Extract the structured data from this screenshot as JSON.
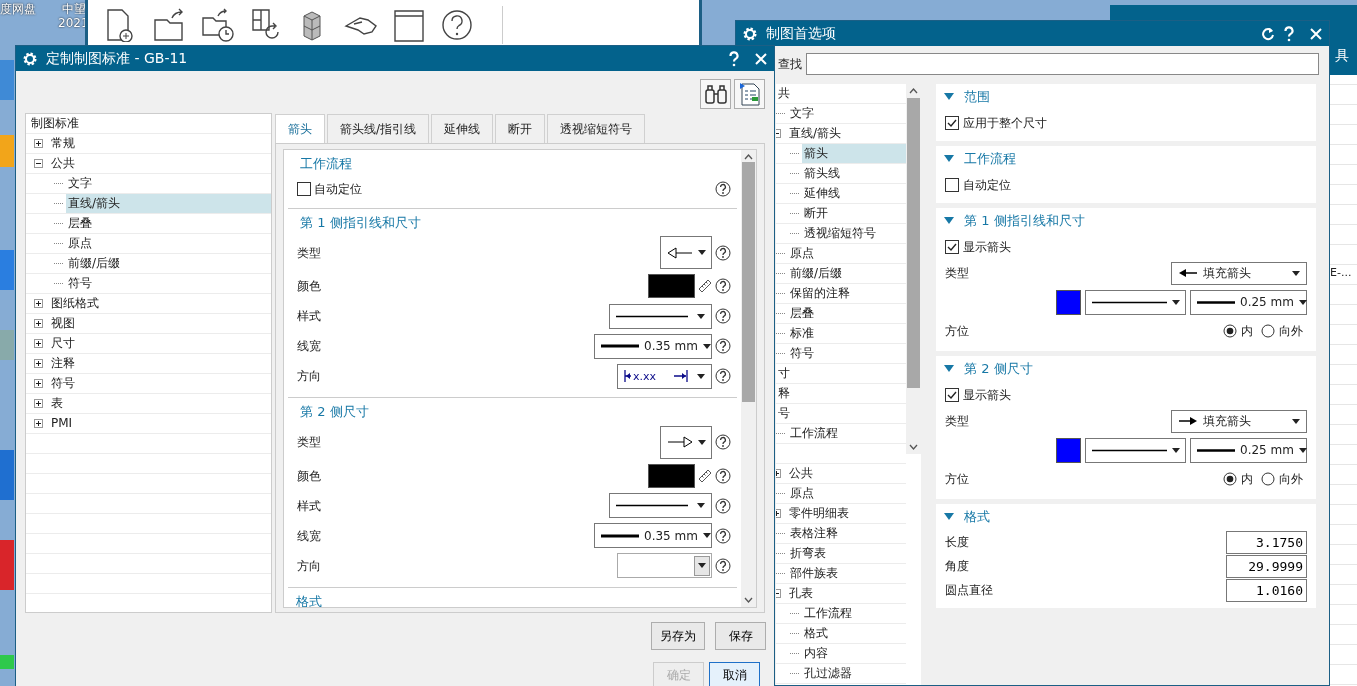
{
  "desktop": {
    "icon_labels": [
      "度网盘",
      "中望",
      "2021"
    ]
  },
  "background_window": {
    "texts": [
      "具",
      "E-..."
    ]
  },
  "preferences_dialog": {
    "title": "制图首选项",
    "search": {
      "label": "查找"
    },
    "tree": [
      {
        "label": "共",
        "children": [
          {
            "label": "文字",
            "selected": false
          },
          {
            "label": "直线/箭头",
            "expanded": true,
            "selected": false,
            "children": [
              {
                "label": "箭头",
                "selected": true
              },
              {
                "label": "箭头线",
                "selected": false
              },
              {
                "label": "延伸线",
                "selected": false
              },
              {
                "label": "断开",
                "selected": false
              },
              {
                "label": "透视缩短符号",
                "selected": false
              }
            ]
          },
          {
            "label": "原点",
            "selected": false
          },
          {
            "label": "前缀/后缀",
            "selected": false
          },
          {
            "label": "保留的注释",
            "selected": false
          },
          {
            "label": "层叠",
            "selected": false
          },
          {
            "label": "标准",
            "selected": false
          },
          {
            "label": "符号",
            "selected": false
          }
        ],
        "selected": false
      },
      {
        "label": "寸",
        "selected": false
      },
      {
        "label": "释",
        "selected": false
      },
      {
        "label": "号",
        "selected": false,
        "children": [
          {
            "label": "工作流程",
            "selected": false
          }
        ]
      },
      {
        "children": [
          {
            "label": "公共",
            "expanded": false,
            "selected": false
          },
          {
            "label": "原点",
            "selected": false
          },
          {
            "label": "零件明细表",
            "expanded": false,
            "selected": false
          },
          {
            "label": "表格注释",
            "selected": false
          },
          {
            "label": "折弯表",
            "selected": false
          },
          {
            "label": "部件族表",
            "selected": false
          },
          {
            "label": "孔表",
            "expanded": true,
            "selected": false,
            "children": [
              {
                "label": "工作流程",
                "selected": false
              },
              {
                "label": "格式",
                "selected": false
              },
              {
                "label": "内容",
                "selected": false
              },
              {
                "label": "孔过滤器",
                "selected": false
              }
            ]
          }
        ]
      }
    ],
    "sections": [
      {
        "title": "范围",
        "expanded": true,
        "rows": [
          {
            "kind": "checkbox",
            "label": "应用于整个尺寸",
            "checked": true
          }
        ]
      },
      {
        "title": "工作流程",
        "expanded": true,
        "rows": [
          {
            "kind": "checkbox",
            "label": "自动定位",
            "checked": false
          }
        ]
      },
      {
        "title": "第 1 侧指引线和尺寸",
        "expanded": true,
        "rows": [
          {
            "kind": "checkbox",
            "label": "显示箭头",
            "checked": true
          },
          {
            "kind": "type",
            "label": "类型",
            "points_left": true,
            "value": "填充箭头"
          },
          {
            "kind": "line",
            "color": "#0000ff",
            "width": "0.25 mm"
          },
          {
            "kind": "radios",
            "label": "方位",
            "options": [
              {
                "label": "内",
                "selected": true
              },
              {
                "label": "向外",
                "selected": false
              }
            ]
          }
        ]
      },
      {
        "title": "第 2 侧尺寸",
        "expanded": true,
        "rows": [
          {
            "kind": "checkbox",
            "label": "显示箭头",
            "checked": true
          },
          {
            "kind": "type",
            "label": "类型",
            "points_left": false,
            "value": "填充箭头"
          },
          {
            "kind": "line",
            "color": "#0000ff",
            "width": "0.25 mm"
          },
          {
            "kind": "radios",
            "label": "方位",
            "options": [
              {
                "label": "内",
                "selected": true
              },
              {
                "label": "向外",
                "selected": false
              }
            ]
          }
        ]
      },
      {
        "title": "格式",
        "expanded": true,
        "rows": [
          {
            "kind": "number",
            "label": "长度",
            "value": "3.1750"
          },
          {
            "kind": "number",
            "label": "角度",
            "value": "29.9999"
          },
          {
            "kind": "number",
            "label": "圆点直径",
            "value": "1.0160"
          }
        ]
      }
    ]
  },
  "standard_dialog": {
    "title": "定制制图标准 - GB-11",
    "tree": {
      "root": "制图标准",
      "items": [
        {
          "label": "常规",
          "expanded": false,
          "selected": false
        },
        {
          "label": "公共",
          "expanded": true,
          "selected": false,
          "children": [
            {
              "label": "文字",
              "selected": false
            },
            {
              "label": "直线/箭头",
              "selected": true
            },
            {
              "label": "层叠",
              "selected": false
            },
            {
              "label": "原点",
              "selected": false
            },
            {
              "label": "前缀/后缀",
              "selected": false
            },
            {
              "label": "符号",
              "selected": false
            }
          ]
        },
        {
          "label": "图纸格式",
          "expanded": false,
          "selected": false
        },
        {
          "label": "视图",
          "expanded": false,
          "selected": false
        },
        {
          "label": "尺寸",
          "expanded": false,
          "selected": false
        },
        {
          "label": "注释",
          "expanded": false,
          "selected": false
        },
        {
          "label": "符号",
          "expanded": false,
          "selected": false
        },
        {
          "label": "表",
          "expanded": false,
          "selected": false
        },
        {
          "label": "PMI",
          "expanded": false,
          "selected": false
        }
      ]
    },
    "tabs": [
      {
        "label": "箭头",
        "selected": true
      },
      {
        "label": "箭头线/指引线",
        "selected": false
      },
      {
        "label": "延伸线",
        "selected": false
      },
      {
        "label": "断开",
        "selected": false
      },
      {
        "label": "透视缩短符号",
        "selected": false
      }
    ],
    "sections": [
      {
        "title": "工作流程",
        "rows": [
          {
            "kind": "checkbox",
            "label": "自动定位",
            "checked": false
          }
        ]
      },
      {
        "title": "第 1 侧指引线和尺寸",
        "rows": [
          {
            "kind": "arrow",
            "label": "类型",
            "points_left": true
          },
          {
            "kind": "color",
            "label": "颜色",
            "color": "#000000"
          },
          {
            "kind": "style",
            "label": "样式"
          },
          {
            "kind": "width",
            "label": "线宽",
            "value": "0.35 mm"
          },
          {
            "kind": "direction",
            "label": "方向",
            "sample": "x.xx"
          }
        ]
      },
      {
        "title": "第 2 侧尺寸",
        "rows": [
          {
            "kind": "arrow",
            "label": "类型",
            "points_left": false
          },
          {
            "kind": "color",
            "label": "颜色",
            "color": "#000000"
          },
          {
            "kind": "style",
            "label": "样式"
          },
          {
            "kind": "width",
            "label": "线宽",
            "value": "0.35 mm"
          },
          {
            "kind": "direction",
            "label": "方向"
          }
        ]
      },
      {
        "title": "格式"
      }
    ],
    "button_rows": [
      [
        {
          "label": "另存为",
          "disabled": false,
          "default": false
        },
        {
          "label": "保存",
          "disabled": false,
          "default": false
        }
      ],
      [
        {
          "label": "确定",
          "disabled": true,
          "default": false
        },
        {
          "label": "取消",
          "disabled": false,
          "default": true
        }
      ]
    ]
  }
}
